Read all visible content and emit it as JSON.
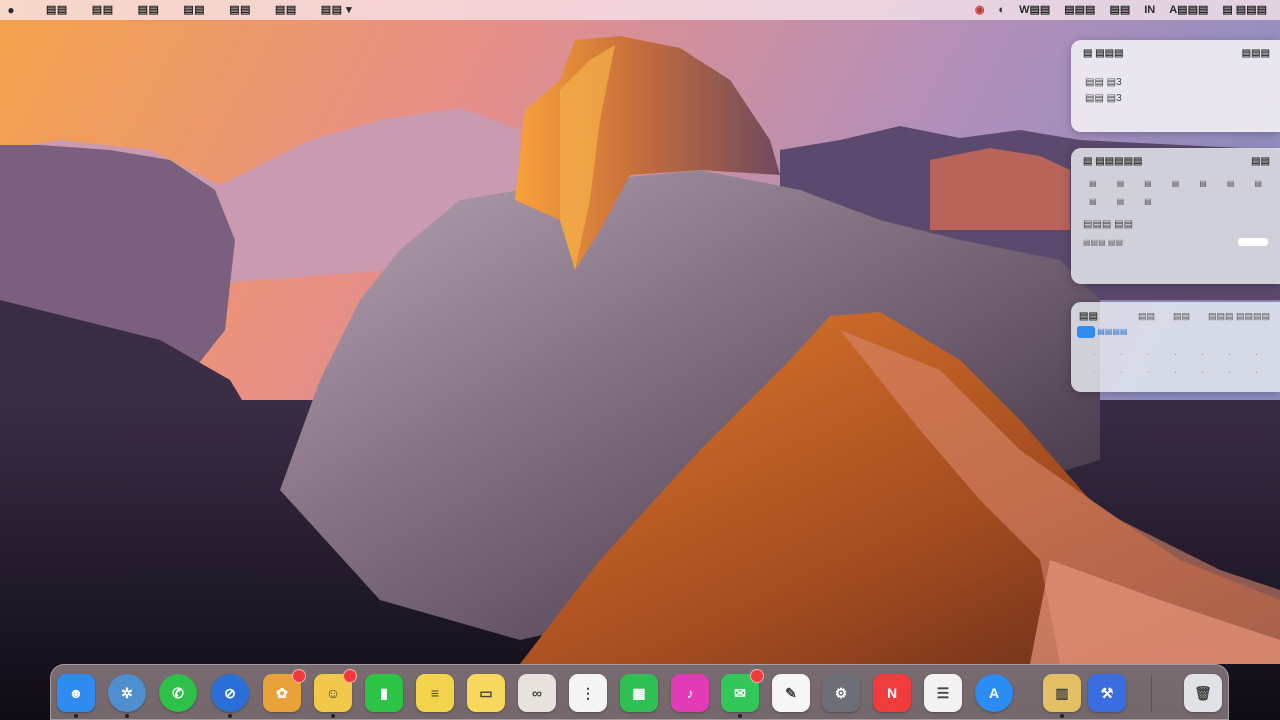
{
  "menubar": {
    "apple_icon": "apple-logo-icon",
    "menus": [
      "▤▤",
      "▤▤",
      "▤▤",
      "▤▤",
      "▤▤",
      "▤▤",
      "▤▤ ▾"
    ],
    "status": {
      "items": [
        "◉",
        "◐",
        "W▤▤",
        "▤▤▤",
        "▤▤",
        "IN",
        "A▤▤▤",
        "▤ ▤▤▤"
      ],
      "icons": [
        "record-icon",
        "control-center-icon"
      ]
    }
  },
  "widgets": {
    "clock": {
      "title": "▤ ▤▤▤",
      "right": "▤▤▤",
      "lines": [
        "▤▤ ▤3",
        "▤▤ ▤3"
      ]
    },
    "calendar": {
      "title": "▤ ▤▤▤▤▤",
      "right": "▤▤",
      "row1": [
        "▤",
        "▤",
        "▤",
        "▤",
        "▤",
        "▤",
        "▤"
      ],
      "row2": [
        "▤",
        "▤",
        "▤",
        "",
        "",
        "",
        ""
      ],
      "line": "▤▤▤ ▤▤",
      "sub": "▤▤▤ ▤▤"
    },
    "reminders": {
      "title": "▤▤",
      "cols": [
        "▤▤",
        "▤▤",
        "▤▤▤ ▤▤▤▤"
      ],
      "item": "▤▤▤▤"
    }
  },
  "dock": {
    "apps": [
      {
        "name": "finder-icon",
        "glyph": "☻",
        "color": "#2d8bf2",
        "shape": "square"
      },
      {
        "name": "launchpad-icon",
        "glyph": "✲",
        "color": "#4f8fd0",
        "shape": "round"
      },
      {
        "name": "facetime-icon",
        "glyph": "✆",
        "color": "#2fc04a",
        "shape": "round"
      },
      {
        "name": "safari-icon",
        "glyph": "⊘",
        "color": "#2a6fd8",
        "shape": "round"
      },
      {
        "name": "photos-icon",
        "glyph": "✿",
        "color": "#e9a23a",
        "shape": "square"
      },
      {
        "name": "contacts-icon",
        "glyph": "☺",
        "color": "#f1c84a",
        "shape": "square"
      },
      {
        "name": "facetime-video-icon",
        "glyph": "▮",
        "color": "#2cc447",
        "shape": "square"
      },
      {
        "name": "notes-icon",
        "glyph": "≡",
        "color": "#f2d34a",
        "shape": "square"
      },
      {
        "name": "stickies-icon",
        "glyph": "▭",
        "color": "#f7d85a",
        "shape": "square"
      },
      {
        "name": "freeform-icon",
        "glyph": "∞",
        "color": "#e8e2dc",
        "shape": "square"
      },
      {
        "name": "reminders-icon",
        "glyph": "⋮",
        "color": "#f4f4f4",
        "shape": "square"
      },
      {
        "name": "numbers-icon",
        "glyph": "▦",
        "color": "#2fbf52",
        "shape": "square"
      },
      {
        "name": "itunes-store-icon",
        "glyph": "♪",
        "color": "#e23bb5",
        "shape": "square"
      },
      {
        "name": "messages-icon",
        "glyph": "✉",
        "color": "#32c759",
        "shape": "square"
      },
      {
        "name": "pages-icon",
        "glyph": "✎",
        "color": "#f6f6f6",
        "shape": "square"
      },
      {
        "name": "system-settings-icon",
        "glyph": "⚙",
        "color": "#6c6f75",
        "shape": "square"
      },
      {
        "name": "news-icon",
        "glyph": "N",
        "color": "#f03c3c",
        "shape": "square"
      },
      {
        "name": "textedit-icon",
        "glyph": "☰",
        "color": "#f2f2f2",
        "shape": "square"
      },
      {
        "name": "app-store-icon",
        "glyph": "A",
        "color": "#2b8cf4",
        "shape": "round"
      },
      {
        "name": "archive-utility-icon",
        "glyph": "▥",
        "color": "#e3c064",
        "shape": "square"
      },
      {
        "name": "xcode-icon",
        "glyph": "⚒",
        "color": "#3a6de0",
        "shape": "square"
      },
      {
        "name": "trash-icon",
        "glyph": "🗑",
        "color": "#dfe3e8",
        "shape": "square"
      }
    ]
  }
}
